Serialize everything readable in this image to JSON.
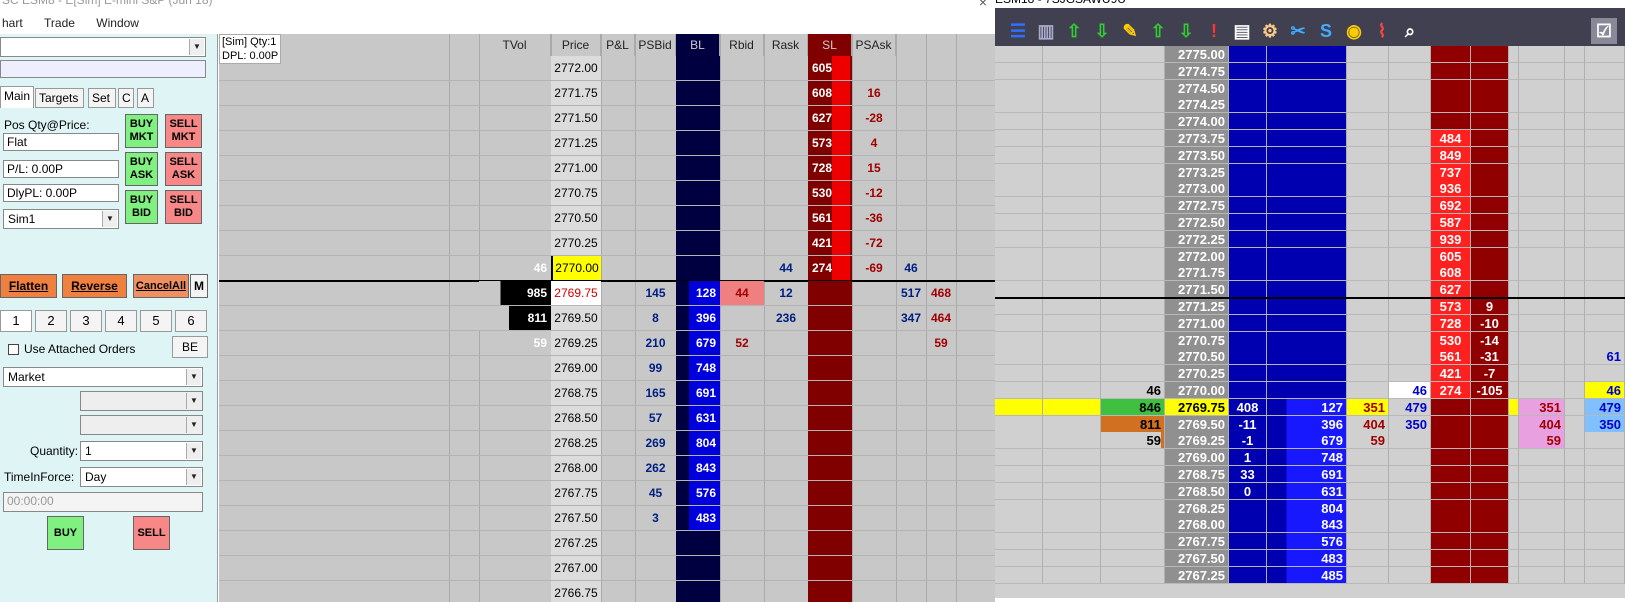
{
  "left_window": {
    "title": "SC ESM8 - E[Sim] E-mini S&P (Jun 18)",
    "menu": [
      "hart",
      "Trade",
      "Window"
    ],
    "close": "×",
    "panel": {
      "tabs": [
        "Main",
        "Targets",
        "Set",
        "C",
        "A"
      ],
      "pos_label": "Pos Qty@Price:",
      "pos_value": "Flat",
      "pl_value": "P/L: 0.00P",
      "dlypl_value": "DlyPL: 0.00P",
      "account": "Sim1",
      "buy_mkt": "BUY MKT",
      "sell_mkt": "SELL MKT",
      "buy_ask": "BUY ASK",
      "sell_ask": "SELL ASK",
      "buy_bid": "BUY BID",
      "sell_bid": "SELL BID",
      "flatten": "Flatten",
      "reverse": "Reverse",
      "cancel_all": "CancelAll",
      "m": "M",
      "qty_buttons": [
        "1",
        "2",
        "3",
        "4",
        "5",
        "6"
      ],
      "use_attached": "Use Attached Orders",
      "be": "BE",
      "order_type": "Market",
      "quantity_label": "Quantity:",
      "quantity": "1",
      "tif_label": "TimeInForce:",
      "tif": "Day",
      "time_placeholder": "00:00:00",
      "buy": "BUY",
      "sell": "SELL"
    },
    "ladder": {
      "info1": "[Sim]  Qty:1",
      "info2": "DPL: 0.00P",
      "headers": [
        "TVol",
        "Price",
        "P&L",
        "PSBid",
        "BL",
        "Rbid",
        "Rask",
        "SL",
        "PSAsk"
      ],
      "rows": [
        {
          "price": "2772.00",
          "sl": "605",
          "psask": ""
        },
        {
          "price": "2771.75",
          "sl": "608",
          "psask": "16"
        },
        {
          "price": "2771.50",
          "sl": "627",
          "psask": "-28"
        },
        {
          "price": "2771.25",
          "sl": "573",
          "psask": "4"
        },
        {
          "price": "2771.00",
          "sl": "728",
          "psask": "15"
        },
        {
          "price": "2770.75",
          "sl": "530",
          "psask": "-12"
        },
        {
          "price": "2770.50",
          "sl": "561",
          "psask": "-36"
        },
        {
          "price": "2770.25",
          "sl": "421",
          "psask": "-72"
        },
        {
          "price": "2770.00",
          "tvol": "46",
          "rask": "44",
          "sl": "274",
          "psask": "-69",
          "x1": "46"
        },
        {
          "price": "2769.75",
          "tvol": "985",
          "psbid": "145",
          "bl": "128",
          "rbid": "44",
          "rask": "12",
          "x1": "517",
          "x2": "468"
        },
        {
          "price": "2769.50",
          "tvol": "811",
          "psbid": "8",
          "bl": "396",
          "rask": "236",
          "x1": "347",
          "x2": "464"
        },
        {
          "price": "2769.25",
          "tvol": "59",
          "psbid": "210",
          "bl": "679",
          "rbid": "52",
          "x2": "59"
        },
        {
          "price": "2769.00",
          "psbid": "99",
          "bl": "748"
        },
        {
          "price": "2768.75",
          "psbid": "165",
          "bl": "691"
        },
        {
          "price": "2768.50",
          "psbid": "57",
          "bl": "631"
        },
        {
          "price": "2768.25",
          "psbid": "269",
          "bl": "804"
        },
        {
          "price": "2768.00",
          "psbid": "262",
          "bl": "843"
        },
        {
          "price": "2767.75",
          "psbid": "45",
          "bl": "576"
        },
        {
          "price": "2767.50",
          "psbid": "3",
          "bl": "483"
        },
        {
          "price": "2767.25"
        },
        {
          "price": "2767.00"
        },
        {
          "price": "2766.75"
        }
      ]
    }
  },
  "right_window": {
    "title": "ESM18 - 7SJGSAWU9U",
    "rows": [
      {
        "price": "2775.00"
      },
      {
        "price": "2774.75"
      },
      {
        "price": "2774.50"
      },
      {
        "price": "2774.25"
      },
      {
        "price": "2774.00"
      },
      {
        "price": "2773.75",
        "ask": "484"
      },
      {
        "price": "2773.50",
        "ask": "849"
      },
      {
        "price": "2773.25",
        "ask": "737"
      },
      {
        "price": "2773.00",
        "ask": "936"
      },
      {
        "price": "2772.75",
        "ask": "692"
      },
      {
        "price": "2772.50",
        "ask": "587"
      },
      {
        "price": "2772.25",
        "ask": "939"
      },
      {
        "price": "2772.00",
        "ask": "605"
      },
      {
        "price": "2771.75",
        "ask": "608"
      },
      {
        "price": "2771.50",
        "ask": "627"
      },
      {
        "price": "2771.25",
        "ask": "573",
        "askd": "9"
      },
      {
        "price": "2771.00",
        "ask": "728",
        "askd": "-10"
      },
      {
        "price": "2770.75",
        "ask": "530",
        "askd": "-14"
      },
      {
        "price": "2770.50",
        "ask": "561",
        "askd": "-31",
        "far": "61"
      },
      {
        "price": "2770.25",
        "ask": "421",
        "askd": "-7"
      },
      {
        "price": "2770.00",
        "vol": "46",
        "c7": "46",
        "ask": "274",
        "askd": "-105",
        "far": "46"
      },
      {
        "price": "2769.75",
        "vol": "846",
        "bidd": "408",
        "bid": "127",
        "c6": "351",
        "c7": "479",
        "pink": "351",
        "far": "479"
      },
      {
        "price": "2769.50",
        "vol": "811",
        "bidd": "-11",
        "bid": "396",
        "c6": "404",
        "c7": "350",
        "pink": "404",
        "far": "350"
      },
      {
        "price": "2769.25",
        "vol": "59",
        "bidd": "-1",
        "bid": "679",
        "c6": "59",
        "pink": "59"
      },
      {
        "price": "2769.00",
        "bidd": "1",
        "bid": "748"
      },
      {
        "price": "2768.75",
        "bidd": "33",
        "bid": "691"
      },
      {
        "price": "2768.50",
        "bidd": "0",
        "bid": "631"
      },
      {
        "price": "2768.25",
        "bid": "804"
      },
      {
        "price": "2768.00",
        "bid": "843"
      },
      {
        "price": "2767.75",
        "bid": "576"
      },
      {
        "price": "2767.50",
        "bid": "483"
      },
      {
        "price": "2767.25",
        "bid": "485"
      }
    ]
  },
  "colors": {
    "bid_blue": "#0000cc",
    "ask_red": "#cc0000",
    "last_yellow": "#ffff00"
  }
}
